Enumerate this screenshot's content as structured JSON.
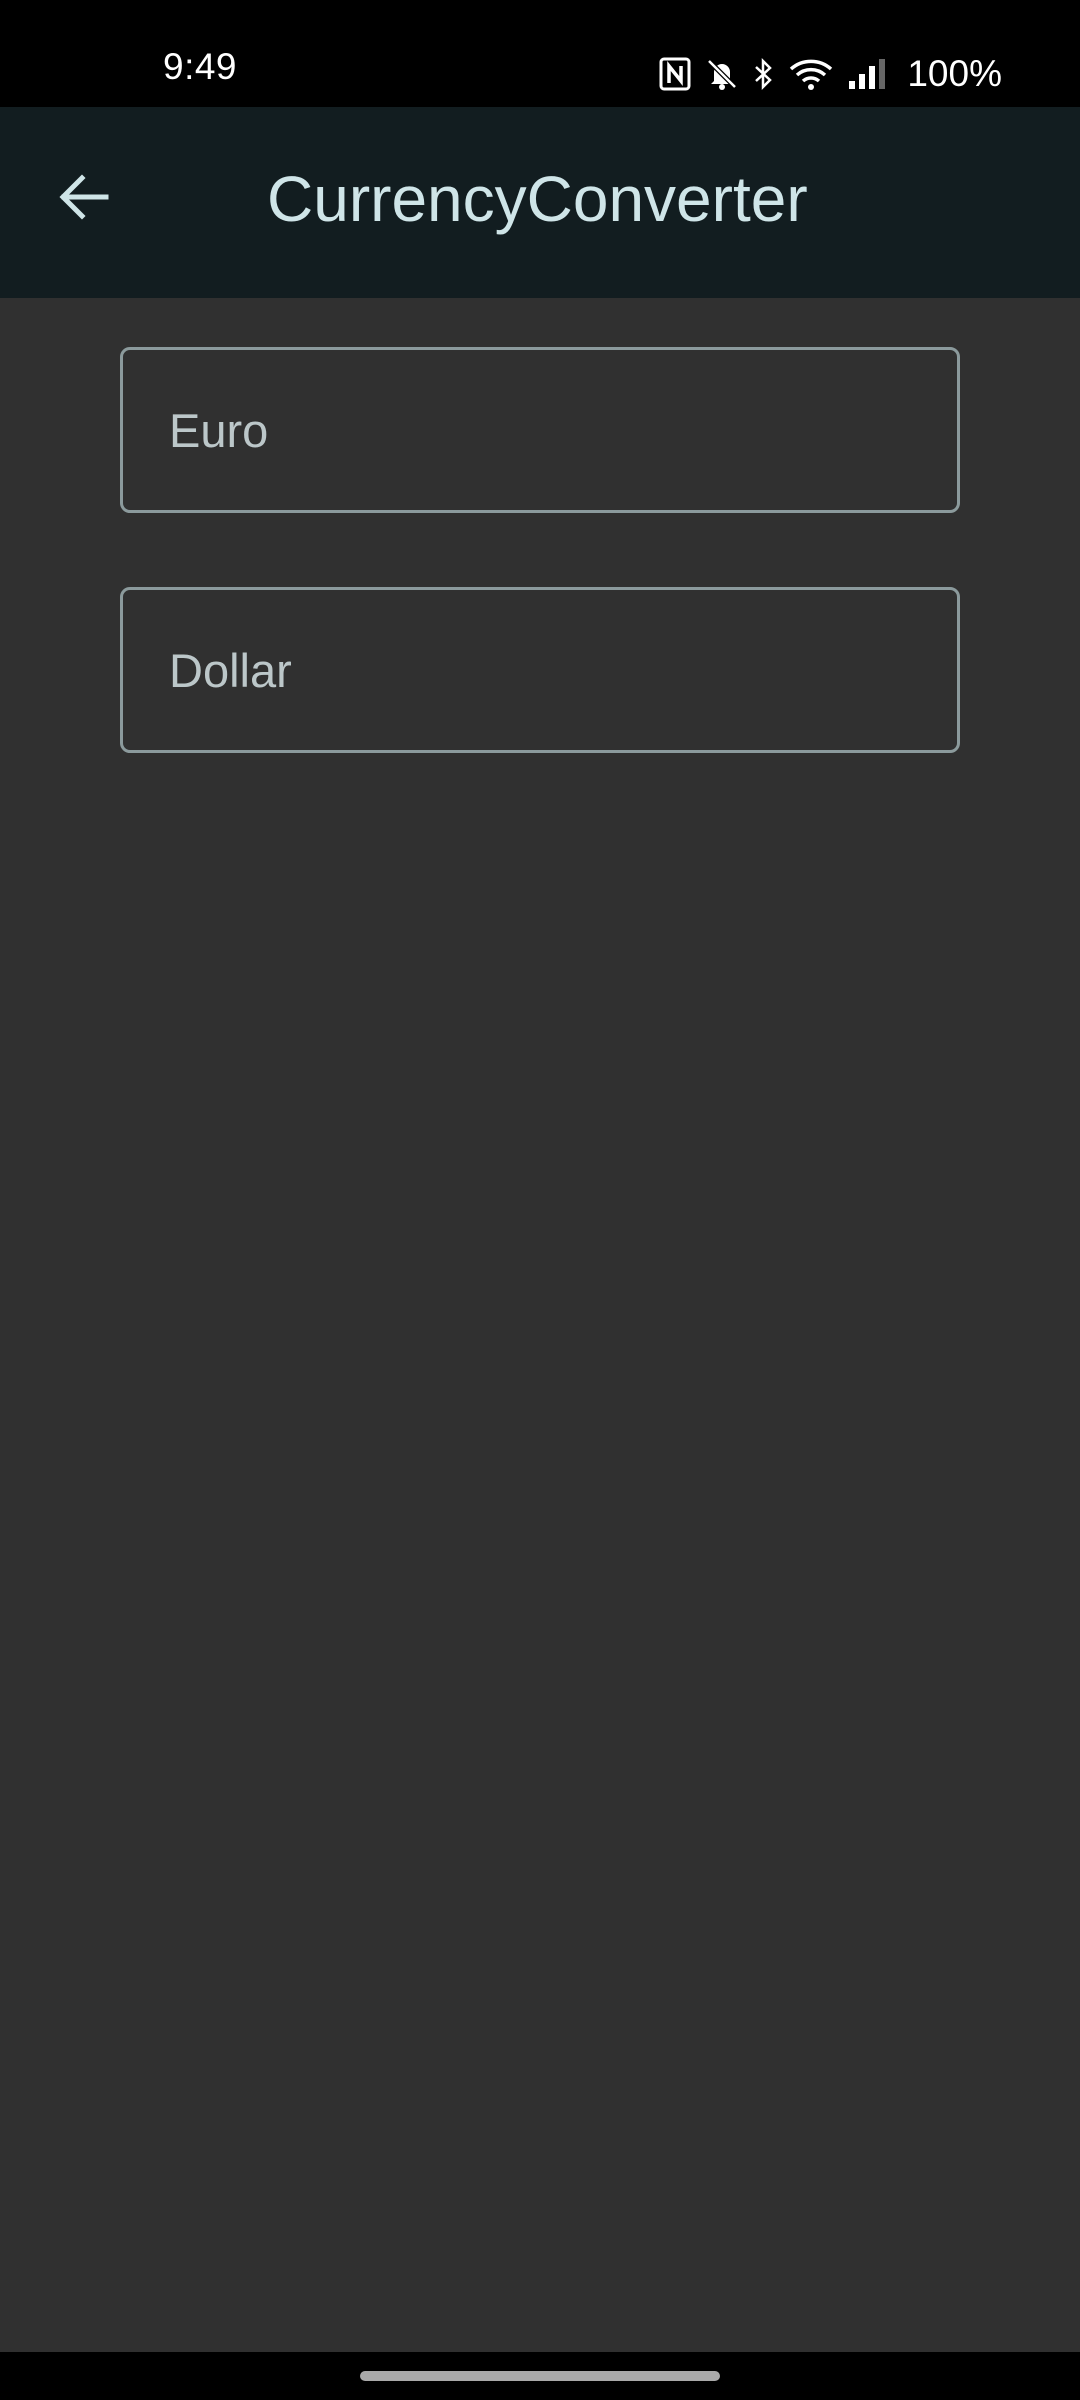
{
  "status_bar": {
    "time": "9:49",
    "battery": "100%",
    "icons": [
      "nfc-icon",
      "bell-off-icon",
      "bluetooth-icon",
      "wifi-icon",
      "signal-icon"
    ]
  },
  "app_bar": {
    "title": "CurrencyConverter",
    "back_icon": "arrow-left-icon"
  },
  "form": {
    "euro_field": {
      "placeholder": "Euro",
      "value": ""
    },
    "dollar_field": {
      "placeholder": "Dollar",
      "value": ""
    }
  },
  "colors": {
    "app_bar_bg": "#121d20",
    "body_bg": "#303030",
    "title_text": "#cfe5e8",
    "field_border": "#8b9a9c"
  }
}
